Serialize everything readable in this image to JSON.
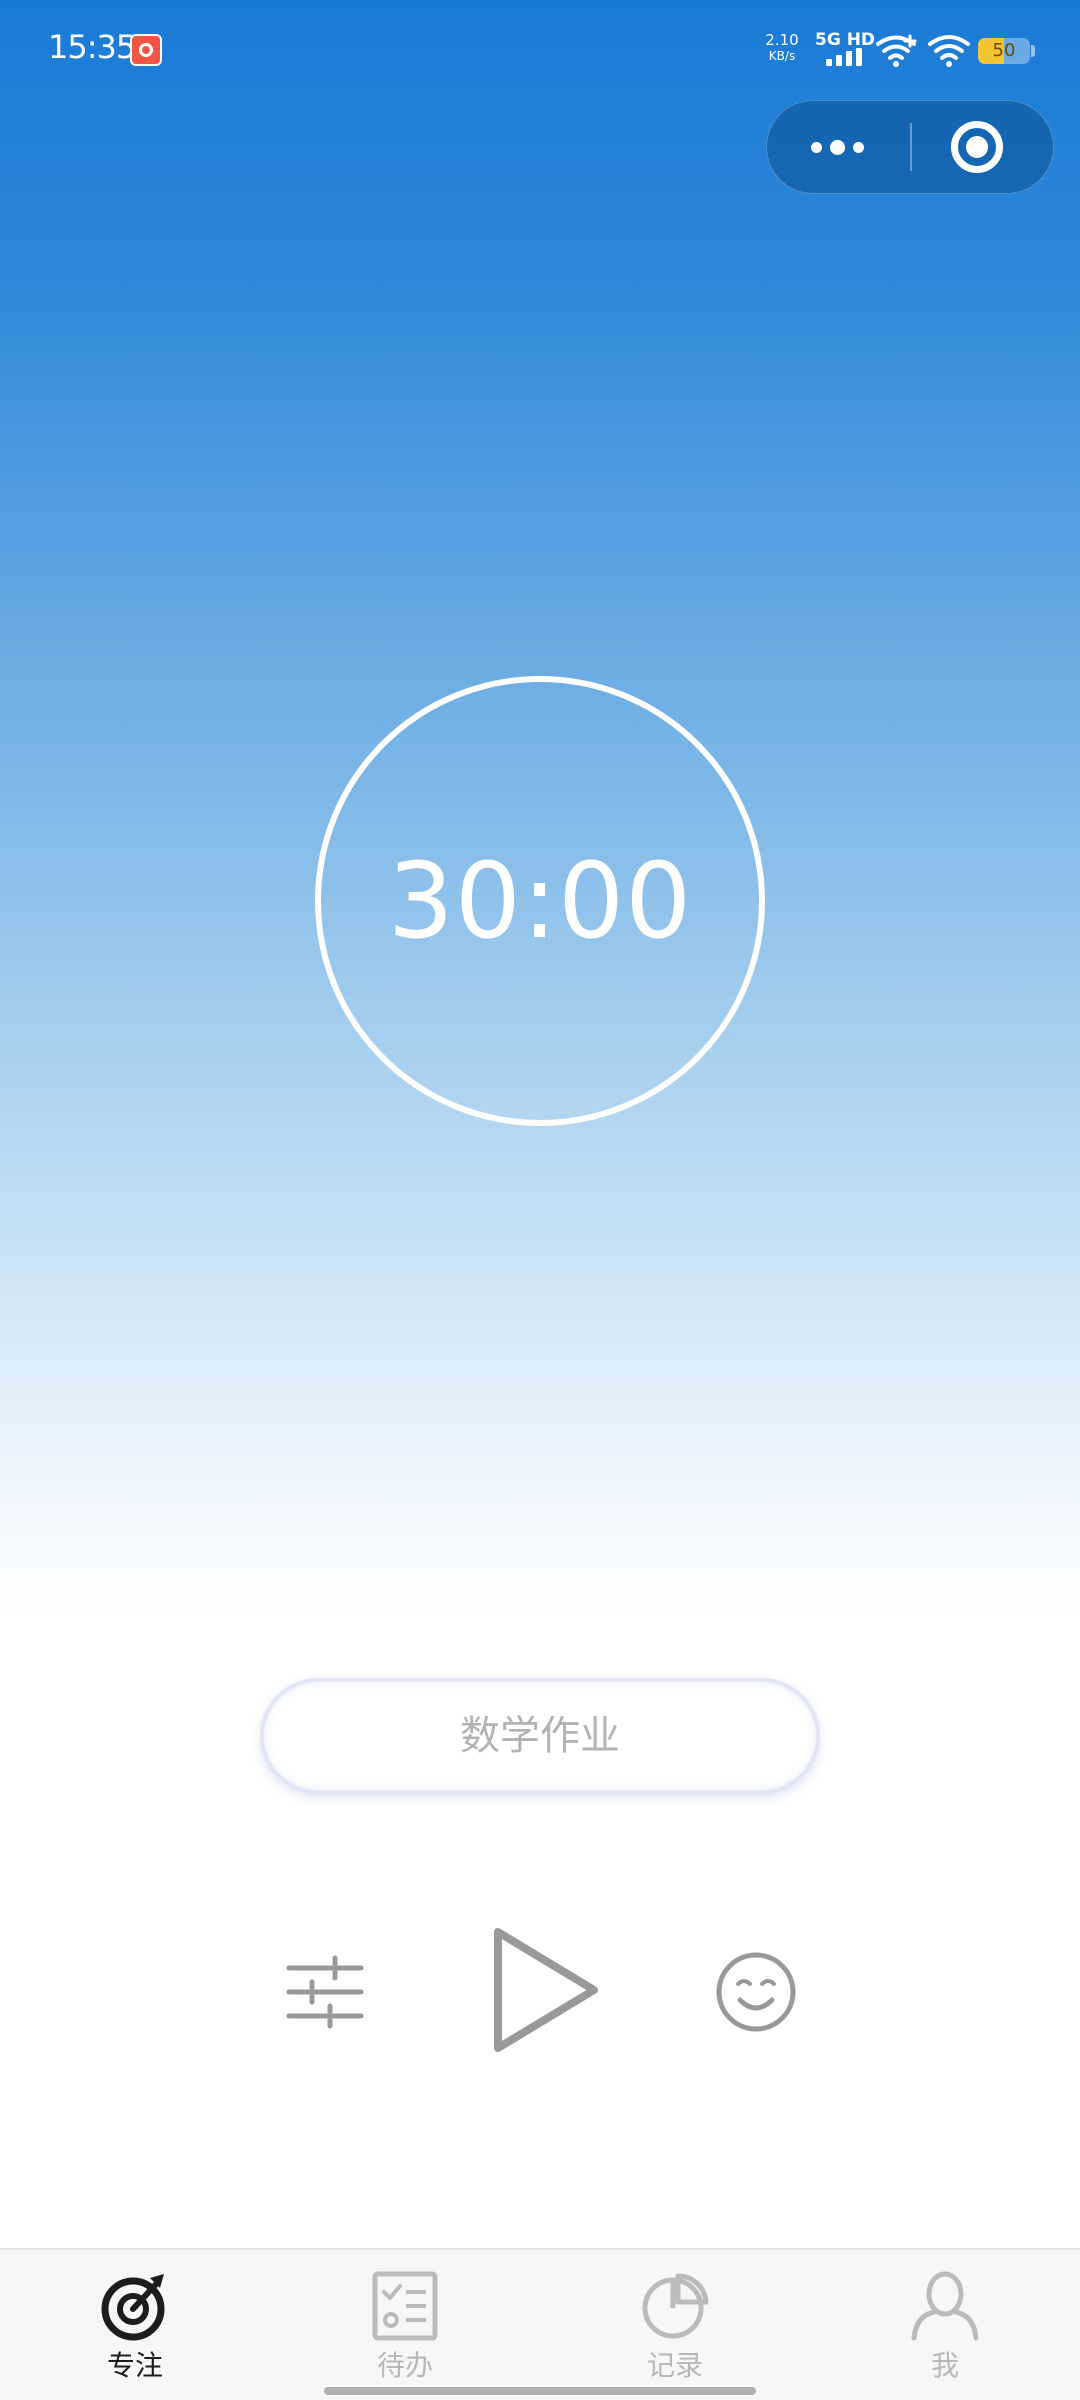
{
  "status_bar": {
    "time": "15:35",
    "net_speed_value": "2.10",
    "net_speed_unit": "KB/s",
    "signal_label": "5G HD",
    "battery_level": "50",
    "battery_fraction": 0.5
  },
  "capsule": {
    "more_icon": "more-dots-icon",
    "close_icon": "target-circle-icon"
  },
  "timer": {
    "display": "30:00"
  },
  "task": {
    "label": "数学作业"
  },
  "controls": {
    "settings_icon": "sliders-icon",
    "play_icon": "play-icon",
    "mood_icon": "smiley-icon"
  },
  "tabbar": {
    "items": [
      {
        "label": "专注",
        "icon": "focus-target-icon",
        "active": true
      },
      {
        "label": "待办",
        "icon": "checklist-icon",
        "active": false
      },
      {
        "label": "记录",
        "icon": "pie-chart-icon",
        "active": false
      },
      {
        "label": "我",
        "icon": "user-icon",
        "active": false
      }
    ]
  },
  "colors": {
    "primary_blue": "#1a7bd6",
    "active_tab": "#1c1c1c",
    "inactive_tab": "#b8b8b8",
    "control_gray": "#999999",
    "battery_yellow": "#f4c532"
  }
}
